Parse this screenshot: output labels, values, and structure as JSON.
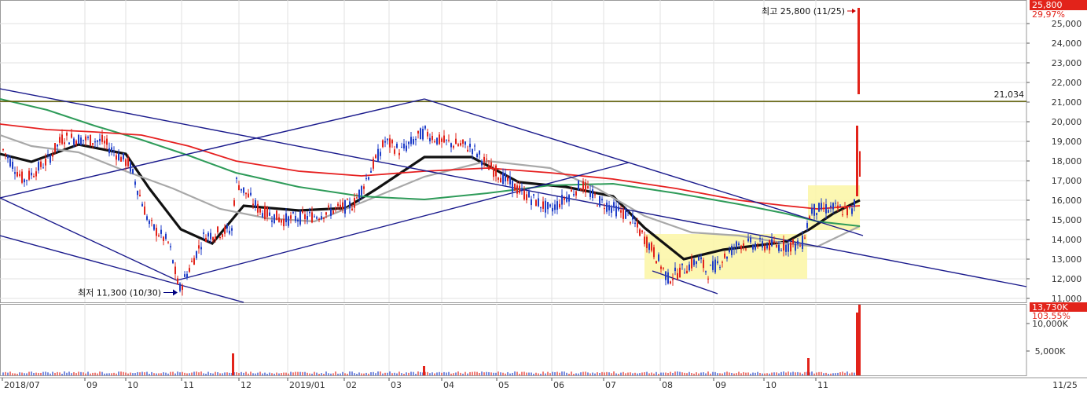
{
  "chart_data": {
    "type": "candlestick",
    "price_axis": {
      "ticks": [
        "25,000",
        "24,000",
        "23,000",
        "22,000",
        "21,000",
        "20,000",
        "19,000",
        "18,000",
        "17,000",
        "16,000",
        "15,000",
        "14,000",
        "13,000",
        "12,000",
        "11,000"
      ],
      "range": [
        10800,
        26200
      ]
    },
    "volume_axis": {
      "ticks": [
        "10,000K",
        "5,000K"
      ]
    },
    "x_axis": {
      "labels": [
        "2018/07",
        "09",
        "10",
        "11",
        "12",
        "2019/01",
        "02",
        "03",
        "04",
        "05",
        "06",
        "07",
        "08",
        "09",
        "10",
        "11"
      ],
      "right_label": "11/25"
    },
    "current_price_badge": "25,800",
    "change_pct_label": "29,97%",
    "volume_badge": "13,730K",
    "volume_pct_label": "103.55%",
    "annotations": {
      "high": {
        "label": "최고 25,800 (11/25)",
        "value": 25800
      },
      "low": {
        "label": "최저 11,300 (10/30)",
        "value": 11300
      },
      "resistance": {
        "label": "21,034",
        "value": 21034
      }
    },
    "ohlc_daily": [
      {
        "x": "2018/07",
        "close": 18500
      },
      {
        "x": "09",
        "close": 19200
      },
      {
        "x": "10",
        "close": 17800
      },
      {
        "x": "11",
        "close": 12500
      },
      {
        "x": "12",
        "close": 15200
      },
      {
        "x": "2019/01",
        "close": 14800
      },
      {
        "x": "02",
        "close": 15800
      },
      {
        "x": "03",
        "close": 19500
      },
      {
        "x": "04",
        "close": 18600
      },
      {
        "x": "05",
        "close": 16300
      },
      {
        "x": "06",
        "close": 16500
      },
      {
        "x": "07",
        "close": 15600
      },
      {
        "x": "08",
        "close": 12600
      },
      {
        "x": "09",
        "close": 13600
      },
      {
        "x": "10",
        "close": 13700
      },
      {
        "x": "11",
        "close": 15400
      },
      {
        "x": "11/25",
        "close": 25800
      }
    ],
    "moving_averages": [
      {
        "color": "#e62020"
      },
      {
        "color": "#2e9b59"
      },
      {
        "color": "#a8a8a8"
      },
      {
        "color": "#111111"
      }
    ],
    "colors": {
      "up": "#e2231a",
      "down": "#1f3ec8",
      "trendline": "#1a1a8c",
      "highlight": "#fbf6a4",
      "resistance": "#5a5a00"
    },
    "grid": true
  }
}
